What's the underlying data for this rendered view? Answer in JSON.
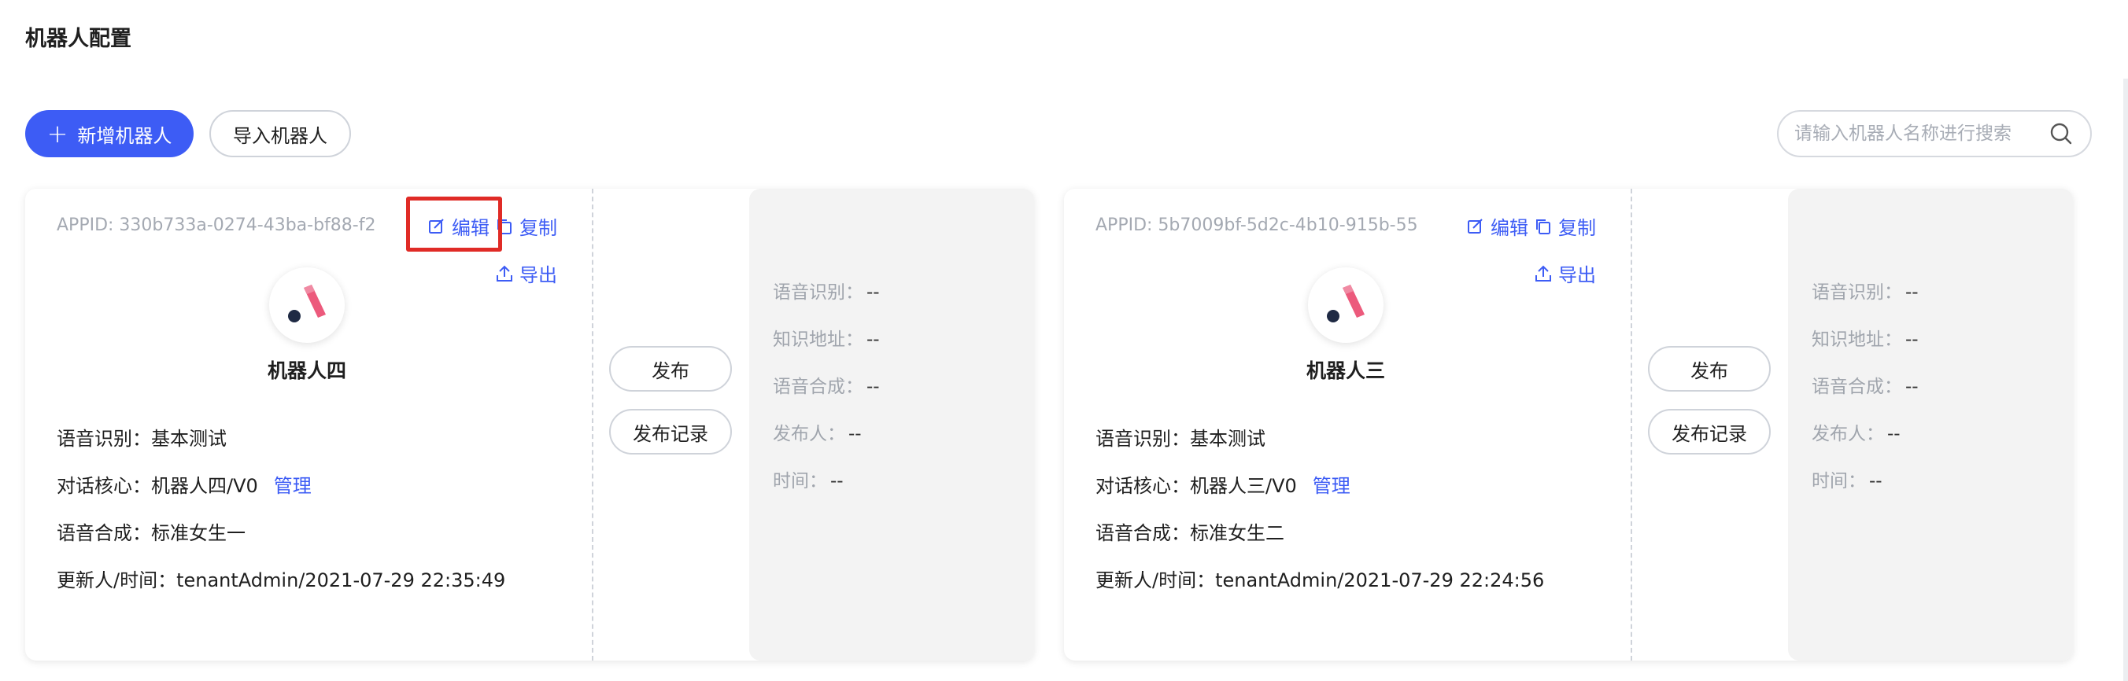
{
  "header": {
    "title": "机器人配置"
  },
  "toolbar": {
    "add_label": "新增机器人",
    "import_label": "导入机器人",
    "search_placeholder": "请输入机器人名称进行搜索"
  },
  "colors": {
    "accent": "#3d5cf5",
    "highlight": "#e02b26"
  },
  "cards": [
    {
      "appid": "APPID: 330b733a-0274-43ba-bf88-f2",
      "edit_label": "编辑",
      "copy_label": "复制",
      "export_label": "导出",
      "name": "机器人四",
      "asr": "语音识别：基本测试",
      "dialog_prefix": "对话核心：机器人四/V0",
      "manage_label": "管理",
      "tts": "语音合成：标准女生一",
      "updated": "更新人/时间：tenantAdmin/2021-07-29 22:35:49",
      "publish_label": "发布",
      "history_label": "发布记录",
      "side": [
        {
          "k": "语音识别：",
          "v": "--"
        },
        {
          "k": "知识地址：",
          "v": "--"
        },
        {
          "k": "语音合成：",
          "v": "--"
        },
        {
          "k": "发布人：",
          "v": "--"
        },
        {
          "k": "时间：",
          "v": "--"
        }
      ]
    },
    {
      "appid": "APPID: 5b7009bf-5d2c-4b10-915b-55",
      "edit_label": "编辑",
      "copy_label": "复制",
      "export_label": "导出",
      "name": "机器人三",
      "asr": "语音识别：基本测试",
      "dialog_prefix": "对话核心：机器人三/V0",
      "manage_label": "管理",
      "tts": "语音合成：标准女生二",
      "updated": "更新人/时间：tenantAdmin/2021-07-29 22:24:56",
      "publish_label": "发布",
      "history_label": "发布记录",
      "side": [
        {
          "k": "语音识别：",
          "v": "--"
        },
        {
          "k": "知识地址：",
          "v": "--"
        },
        {
          "k": "语音合成：",
          "v": "--"
        },
        {
          "k": "发布人：",
          "v": "--"
        },
        {
          "k": "时间：",
          "v": "--"
        }
      ]
    }
  ]
}
